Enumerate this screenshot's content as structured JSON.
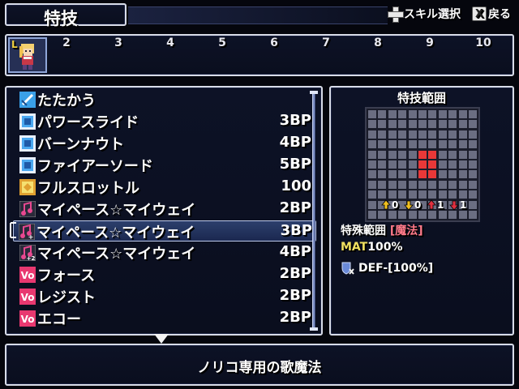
{
  "header": {
    "title": "特技",
    "controls": [
      {
        "icon": "dpad-icon",
        "label": "スキル選択"
      },
      {
        "icon": "x-button-icon",
        "icon_text": "X",
        "label": "戻る"
      }
    ]
  },
  "turn_order": {
    "active_label": "L",
    "numbers": [
      "2",
      "3",
      "4",
      "5",
      "6",
      "7",
      "8",
      "9",
      "10"
    ]
  },
  "skills": [
    {
      "name": "たたかう",
      "cost": "",
      "icon": "attack-icon",
      "icon_color": "#3aa0e8"
    },
    {
      "name": "パワースライド",
      "cost": "3BP",
      "icon": "skill-square-icon",
      "icon_color": "#4aa8f0"
    },
    {
      "name": "バーンナウト",
      "cost": "4BP",
      "icon": "skill-square-icon",
      "icon_color": "#4aa8f0"
    },
    {
      "name": "ファイアーソード",
      "cost": "5BP",
      "icon": "skill-square-icon",
      "icon_color": "#4aa8f0"
    },
    {
      "name": "フルスロットル",
      "cost": "100",
      "icon": "special-icon",
      "icon_color": "#e0a030"
    },
    {
      "name": "マイペース☆マイウェイ",
      "cost": "2BP",
      "icon": "music-note-icon",
      "icon_color": "#e84890"
    },
    {
      "name": "マイペース☆マイウェイ",
      "cost": "3BP",
      "icon": "music-note-plus-icon",
      "icon_color": "#e84890"
    },
    {
      "name": "マイペース☆マイウェイ",
      "cost": "4BP",
      "icon": "music-note-plus2-icon",
      "icon_color": "#e84890"
    },
    {
      "name": "フォース",
      "cost": "2BP",
      "icon": "vo-icon",
      "icon_color": "#e83870"
    },
    {
      "name": "レジスト",
      "cost": "2BP",
      "icon": "vo-icon",
      "icon_color": "#e83870"
    },
    {
      "name": "エコー",
      "cost": "2BP",
      "icon": "vo-icon",
      "icon_color": "#e83870"
    }
  ],
  "selected_index": 6,
  "range_panel": {
    "title": "特技範囲",
    "grid_size": 11,
    "hit_cells": [
      [
        5,
        4
      ],
      [
        6,
        4
      ],
      [
        5,
        5
      ],
      [
        6,
        5
      ],
      [
        5,
        6
      ],
      [
        6,
        6
      ]
    ],
    "modifiers": [
      {
        "icon": "up-arrow-icon",
        "color": "#f0c020",
        "value": "0"
      },
      {
        "icon": "down-arrow-icon",
        "color": "#f0c020",
        "value": "0"
      },
      {
        "icon": "up-arrow-icon",
        "color": "#e03040",
        "value": "1"
      },
      {
        "icon": "down-arrow-icon",
        "color": "#e03040",
        "value": "1"
      }
    ],
    "type_label": "特殊範囲",
    "type_value": "[魔法]",
    "mat_label": "MAT",
    "mat_value": "100%",
    "def_text": "DEF-[100%]"
  },
  "description": "ノリコ専用の歌魔法"
}
